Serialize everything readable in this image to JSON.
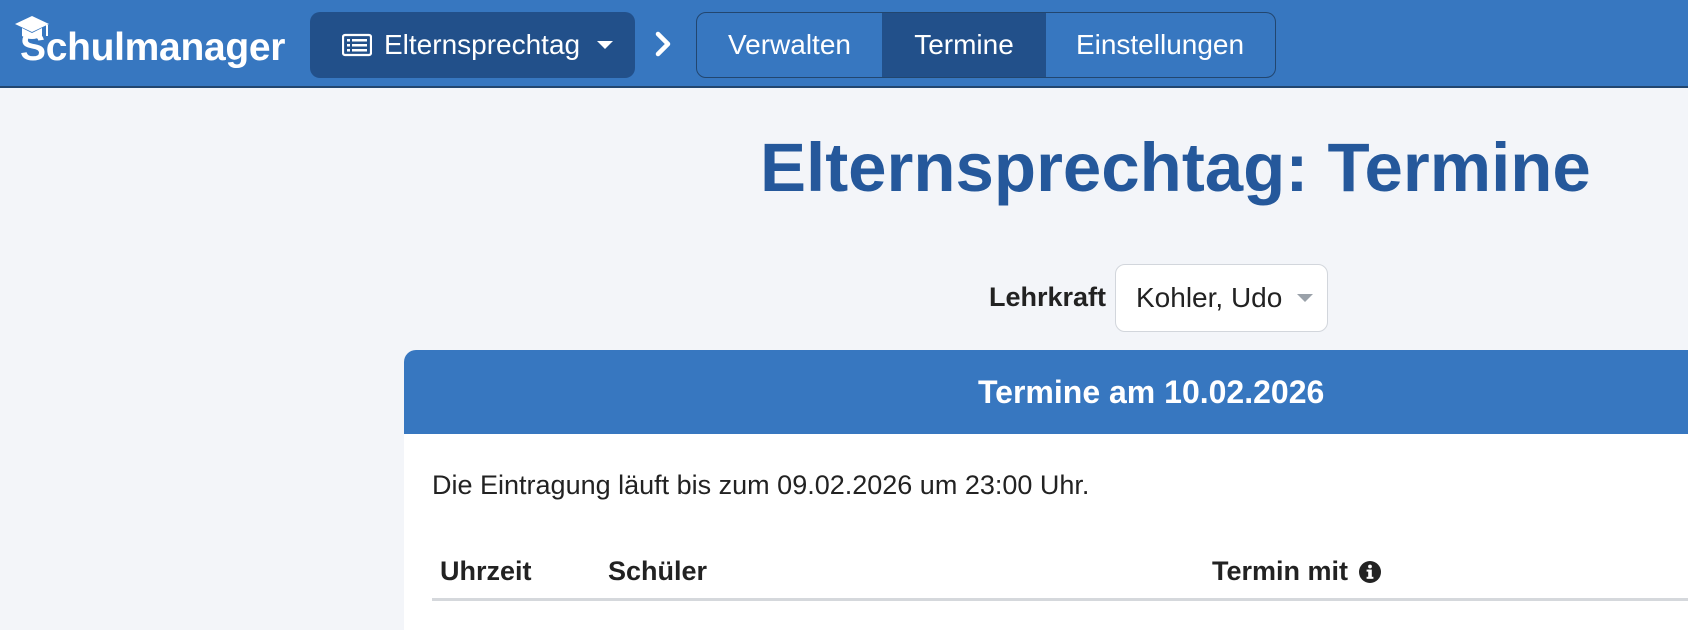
{
  "navbar": {
    "brand": "Schulmanager",
    "module_dropdown_label": "Elternsprechtag",
    "tabs": [
      {
        "label": "Verwalten",
        "active": false
      },
      {
        "label": "Termine",
        "active": true
      },
      {
        "label": "Einstellungen",
        "active": false
      }
    ]
  },
  "page": {
    "title": "Elternsprechtag: Termine",
    "teacher_label": "Lehrkraft",
    "teacher_selected": "Kohler, Udo"
  },
  "card": {
    "header": "Termine am 10.02.2026",
    "deadline_text": "Die Eintragung läuft bis zum 09.02.2026 um 23:00 Uhr.",
    "columns": [
      "Uhrzeit",
      "Schüler",
      "Termin mit"
    ]
  },
  "icons": {
    "logo": "graduation-cap-icon",
    "module": "list-icon",
    "dropdown": "caret-down-icon",
    "breadcrumb": "chevron-right-icon",
    "info": "info-circle-icon"
  },
  "colors": {
    "primary": "#3777c0",
    "primary_dark": "#22508a",
    "title": "#25589b",
    "background": "#f3f5f9"
  }
}
